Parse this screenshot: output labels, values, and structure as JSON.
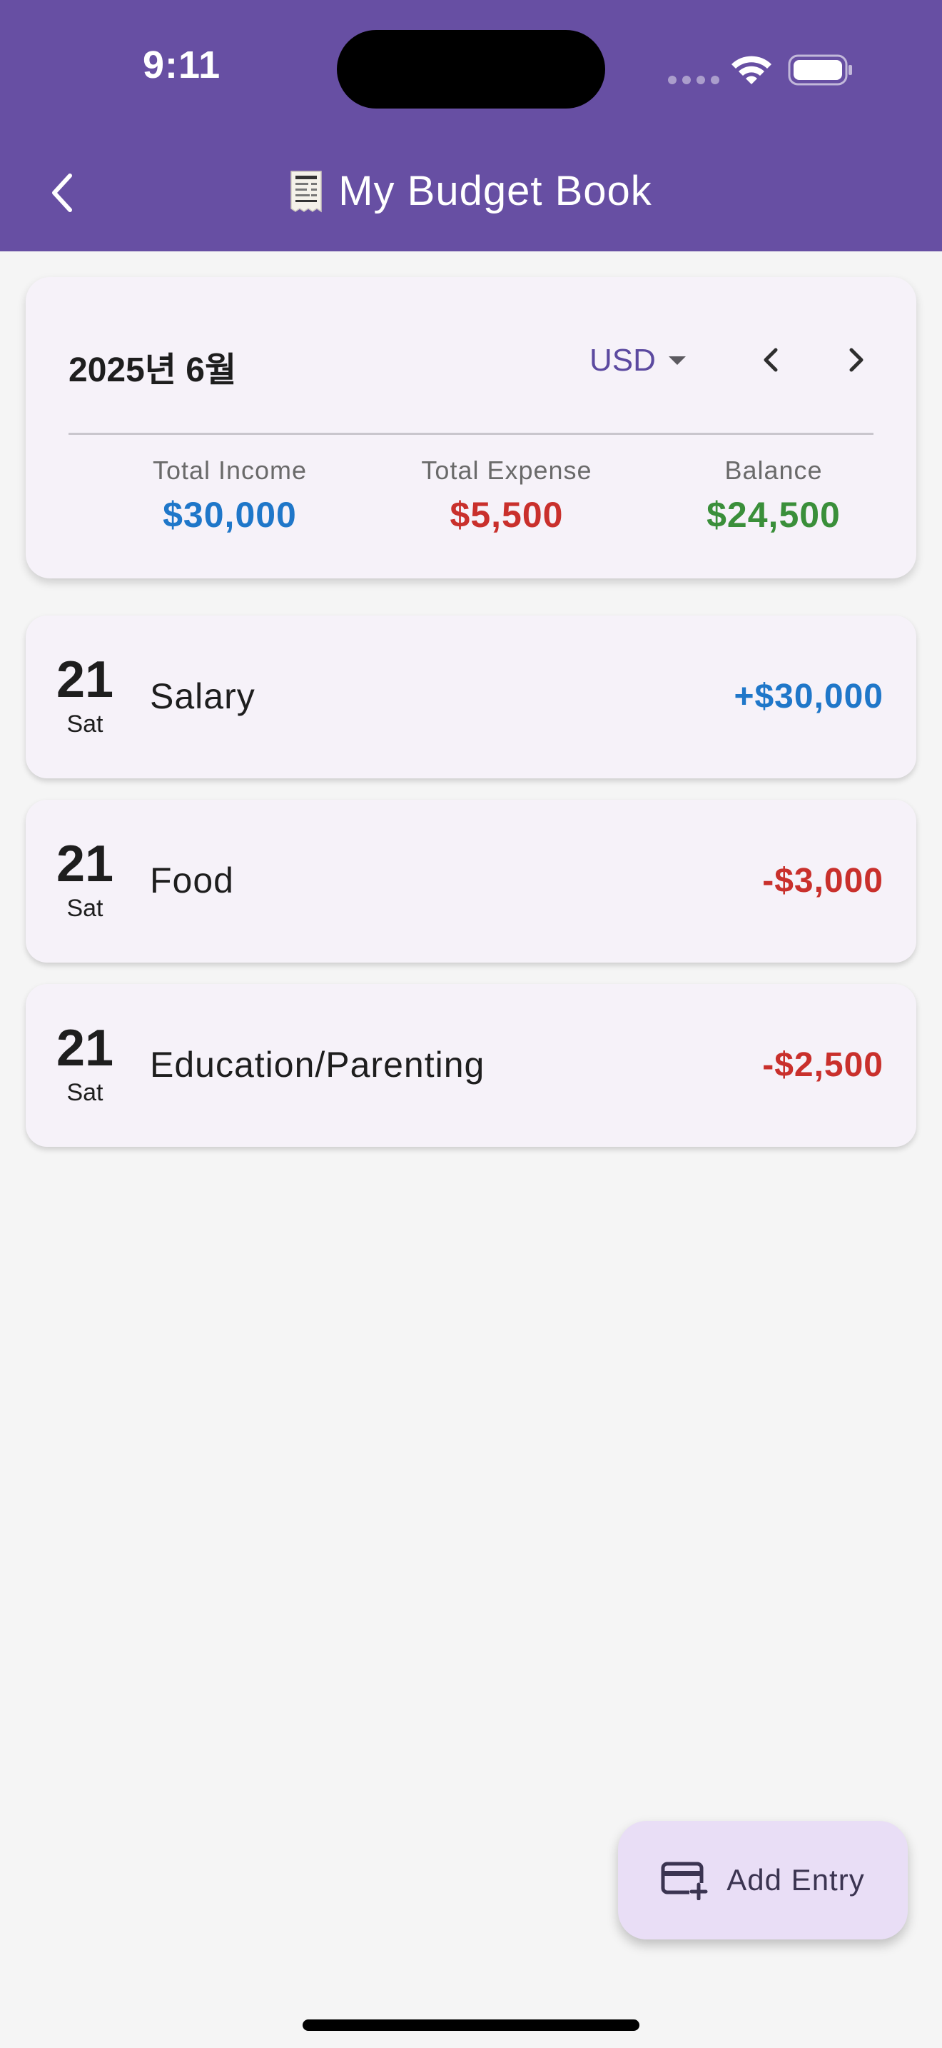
{
  "status_bar": {
    "time": "9:11"
  },
  "app_bar": {
    "title": "My Budget Book",
    "back_icon": "chevron-left-icon",
    "title_icon": "receipt-icon",
    "color": "#674fa3"
  },
  "summary": {
    "month": "2025년 6월",
    "currency": "USD",
    "income_label": "Total Income",
    "income_value": "$30,000",
    "expense_label": "Total Expense",
    "expense_value": "$5,500",
    "balance_label": "Balance",
    "balance_value": "$24,500",
    "income_color": "#1f77c9",
    "expense_color": "#c9302c",
    "balance_color": "#3a8f3a"
  },
  "entries": [
    {
      "day": "21",
      "weekday": "Sat",
      "category": "Salary",
      "amount": "+$30,000",
      "type": "income"
    },
    {
      "day": "21",
      "weekday": "Sat",
      "category": "Food",
      "amount": "-$3,000",
      "type": "expense"
    },
    {
      "day": "21",
      "weekday": "Sat",
      "category": "Education/Parenting",
      "amount": "-$2,500",
      "type": "expense"
    }
  ],
  "fab": {
    "label": "Add Entry",
    "icon": "card-add-icon"
  }
}
